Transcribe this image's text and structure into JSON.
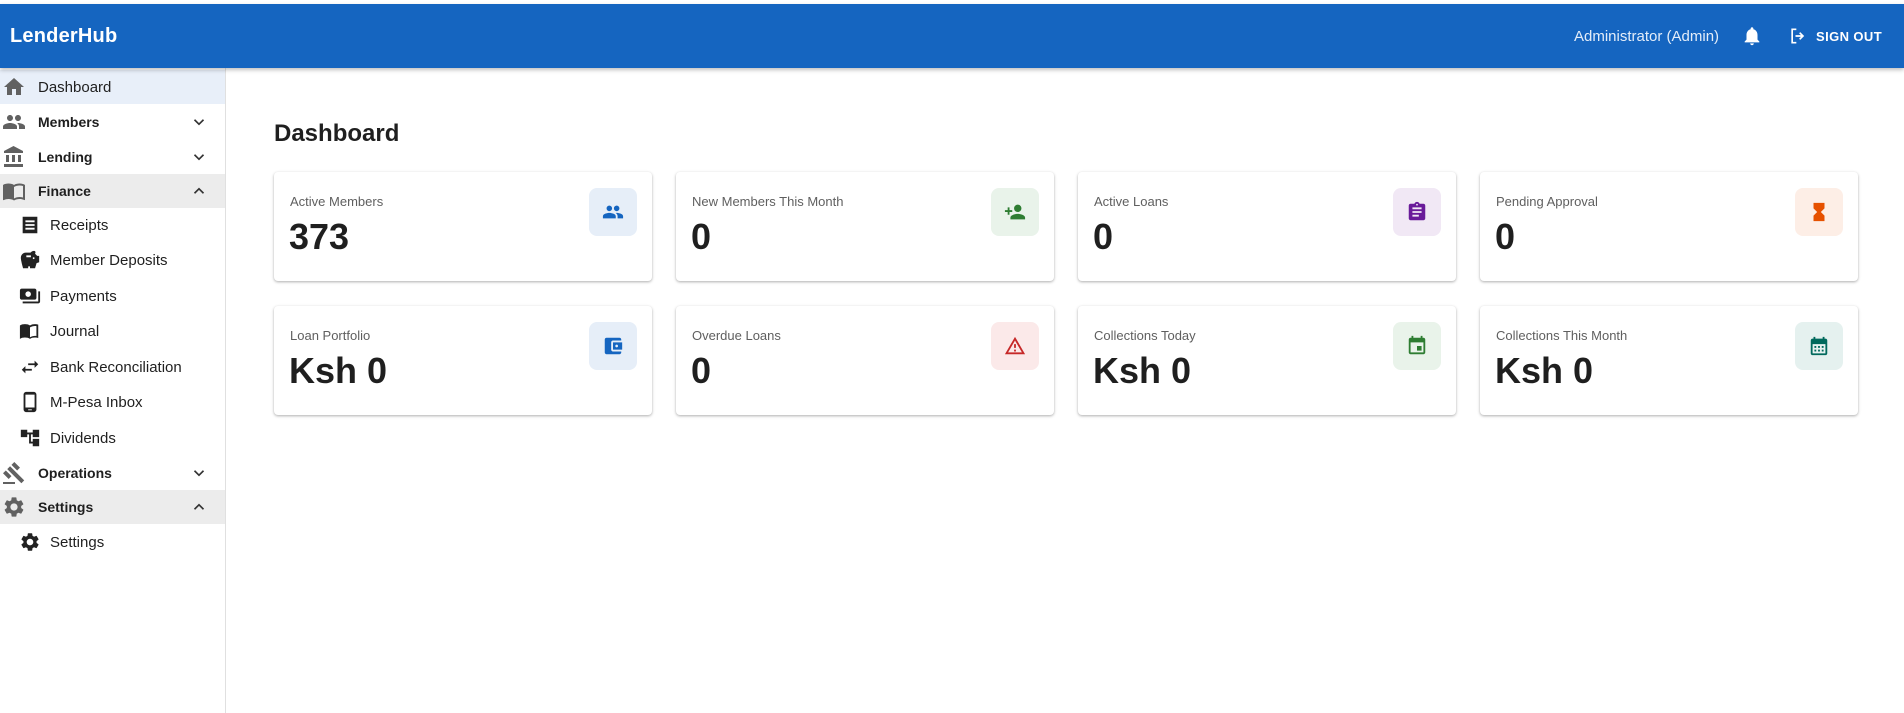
{
  "app": {
    "brand": "LenderHub",
    "user": "Administrator (Admin)",
    "sign_out": "SIGN OUT"
  },
  "sidebar": {
    "dashboard": "Dashboard",
    "members": "Members",
    "lending": "Lending",
    "finance": "Finance",
    "finance_items": {
      "receipts": "Receipts",
      "member_deposits": "Member Deposits",
      "payments": "Payments",
      "journal": "Journal",
      "bank_reconciliation": "Bank Reconciliation",
      "mpesa_inbox": "M-Pesa Inbox",
      "dividends": "Dividends"
    },
    "operations": "Operations",
    "settings": "Settings",
    "settings_items": {
      "settings": "Settings"
    }
  },
  "main": {
    "title": "Dashboard",
    "cards": [
      {
        "label": "Active Members",
        "value": "373",
        "icon": "people-icon",
        "color": "#1565c0",
        "bg": "#e6eef8"
      },
      {
        "label": "New Members This Month",
        "value": "0",
        "icon": "person-add-icon",
        "color": "#2e7d32",
        "bg": "#e9f3ea"
      },
      {
        "label": "Active Loans",
        "value": "0",
        "icon": "assignment-icon",
        "color": "#6a1b9a",
        "bg": "#f1e8f5"
      },
      {
        "label": "Pending Approval",
        "value": "0",
        "icon": "hourglass-icon",
        "color": "#e65100",
        "bg": "#fdeee6"
      },
      {
        "label": "Loan Portfolio",
        "value": "Ksh 0",
        "icon": "wallet-icon",
        "color": "#1565c0",
        "bg": "#e6eef8"
      },
      {
        "label": "Overdue Loans",
        "value": "0",
        "icon": "warning-icon",
        "color": "#c62828",
        "bg": "#fbe9e9"
      },
      {
        "label": "Collections Today",
        "value": "Ksh 0",
        "icon": "event-icon",
        "color": "#2e7d32",
        "bg": "#e9f3ea"
      },
      {
        "label": "Collections This Month",
        "value": "Ksh 0",
        "icon": "calendar-month-icon",
        "color": "#00695c",
        "bg": "#e5f1ef"
      }
    ]
  }
}
